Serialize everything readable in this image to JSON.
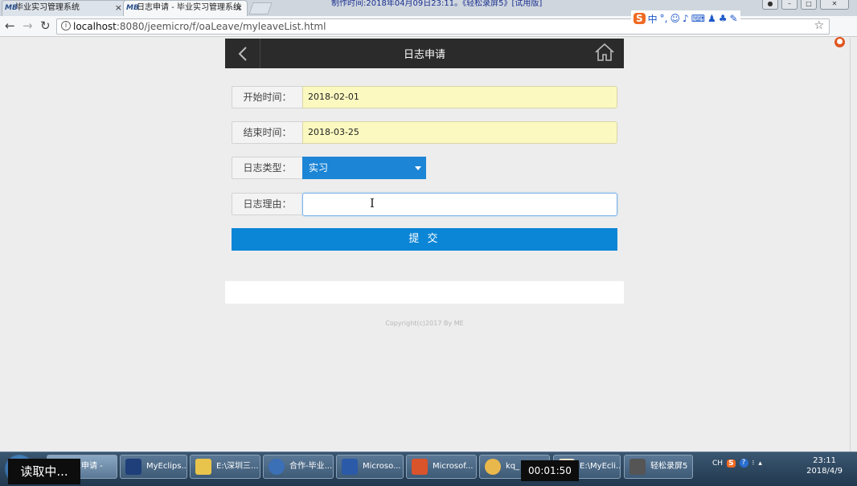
{
  "browser": {
    "tabs": [
      {
        "icon": "MB",
        "label": "毕业实习管理系统",
        "close": "×"
      },
      {
        "icon": "MB",
        "label": "日志申请 - 毕业实习管理系统",
        "close": "×"
      }
    ],
    "recording_banner": "制作时间:2018年04月09日23:11。《轻松录屏5》[试用版]",
    "address": {
      "host": "localhost",
      "path": ":8080/jeemicro/f/oaLeave/myleaveList.html"
    }
  },
  "ime": {
    "logo": "S",
    "mode": "中",
    "punct": "°,"
  },
  "page": {
    "title": "日志申请",
    "form": {
      "start_label": "开始时间：",
      "start_value": "2018-02-01",
      "end_label": "结束时间：",
      "end_value": "2018-03-25",
      "type_label": "日志类型：",
      "type_value": "实习",
      "reason_label": "日志理由：",
      "reason_value": ""
    },
    "submit_label": "提 交",
    "copyright": "Copyright(c)2017 By ME"
  },
  "taskbar": {
    "items": [
      {
        "label": "志申请 -",
        "color": "#d9432b"
      },
      {
        "label": "MyEclips...",
        "color": "#1f3f7a"
      },
      {
        "label": "E:\\深圳三...",
        "color": "#e9c44c"
      },
      {
        "label": "合作-毕业...",
        "color": "#3b6fb6"
      },
      {
        "label": "Microso...",
        "color": "#2b5aa8"
      },
      {
        "label": "Microsof...",
        "color": "#d9532b"
      },
      {
        "label": "kq_",
        "color": "#e9b84c"
      },
      {
        "label": "E:\\MyEcli...",
        "color": "#e9e2c8"
      },
      {
        "label": "轻松录屏5",
        "color": "#555555"
      }
    ],
    "tray_lang": "CH",
    "clock_time": "23:11",
    "clock_date": "2018/4/9"
  },
  "overlays": {
    "reading": "读取中...",
    "timer": "00:01:50"
  }
}
